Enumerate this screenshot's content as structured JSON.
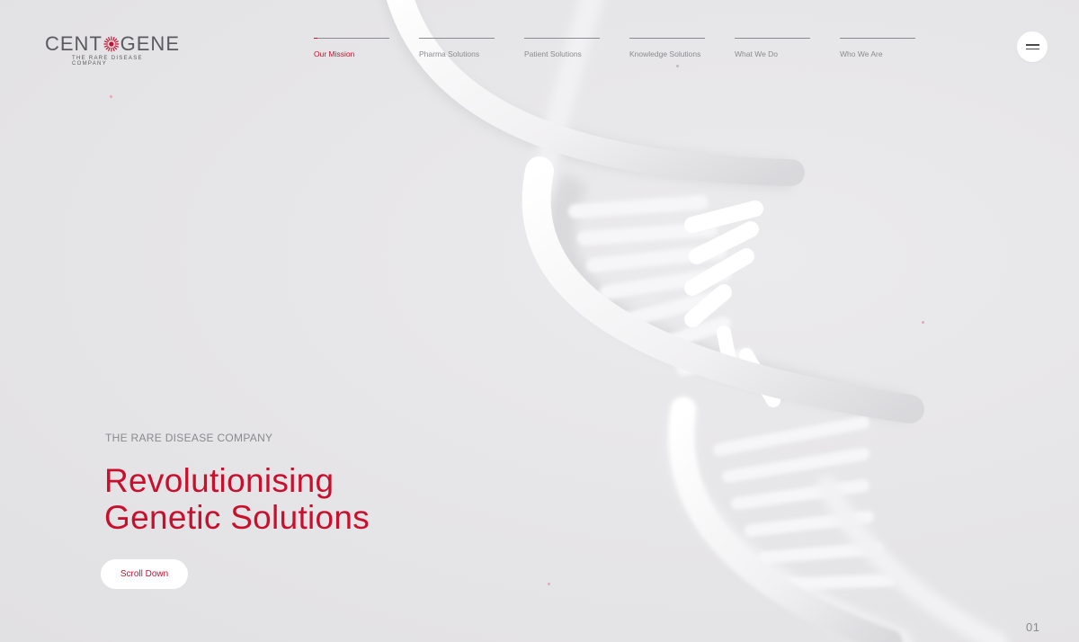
{
  "brand": {
    "name_left": "CENT",
    "name_right": "GENE",
    "tagline": "THE RARE DISEASE COMPANY",
    "sun_icon": "sunburst-icon",
    "accent_color": "#c8102e"
  },
  "nav": {
    "items": [
      {
        "label": "Our Mission",
        "active": true
      },
      {
        "label": "Pharma Solutions",
        "active": false
      },
      {
        "label": "Patient Solutions",
        "active": false
      },
      {
        "label": "Knowledge Solutions",
        "active": false
      },
      {
        "label": "What We Do",
        "active": false
      },
      {
        "label": "Who We Are",
        "active": false
      }
    ],
    "menu_icon": "hamburger-icon"
  },
  "hero": {
    "eyebrow": "THE RARE DISEASE COMPANY",
    "headline_line1": "Revolutionising",
    "headline_line2": "Genetic Solutions",
    "cta_label": "Scroll Down"
  },
  "pager": {
    "current": "01"
  },
  "colors": {
    "background": "#e7e6e8",
    "accent": "#c8102e",
    "muted_text": "#8a898d"
  }
}
